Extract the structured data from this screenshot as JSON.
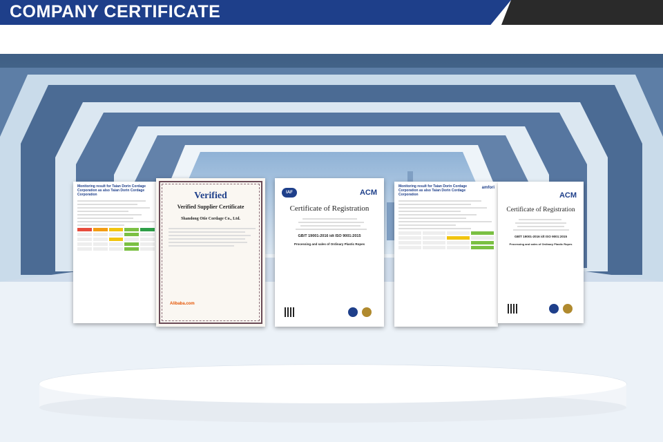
{
  "header": {
    "title": "COMPANY CERTIFICATE",
    "colors": {
      "primary": "#1e3f8a",
      "secondary": "#2a2a2a"
    }
  },
  "certificates": [
    {
      "id": "monitoring-left",
      "title": "Monitoring result for Taian Dorin Cordage Corporation as also Taian Dorin Cordage Corporation"
    },
    {
      "id": "verified-supplier",
      "logo": "Verified",
      "title": "Verified Supplier Certificate",
      "company": "Shandong Otie Cordage Co., Ltd.",
      "brand": "Alibaba.com"
    },
    {
      "id": "registration-center",
      "logo_left": "IAF",
      "logo_right": "ACM",
      "title": "Certificate of Registration",
      "standard": "GB/T 19001-2016 idt ISO 9001:2015",
      "scope": "Processing and sales of Ordinary Plastic Ropes"
    },
    {
      "id": "monitoring-right",
      "logo": "amfori",
      "title": "Monitoring result for Taian Dorin Cordage Corporation as also Taian Dorin Cordage Corporation"
    },
    {
      "id": "registration-right",
      "logo_right": "ACM",
      "title": "Certificate of Registration",
      "standard": "GB/T 19001-2016 idt ISO 9001:2015",
      "scope": "Processing and sales of Ordinary Plastic Ropes"
    }
  ]
}
